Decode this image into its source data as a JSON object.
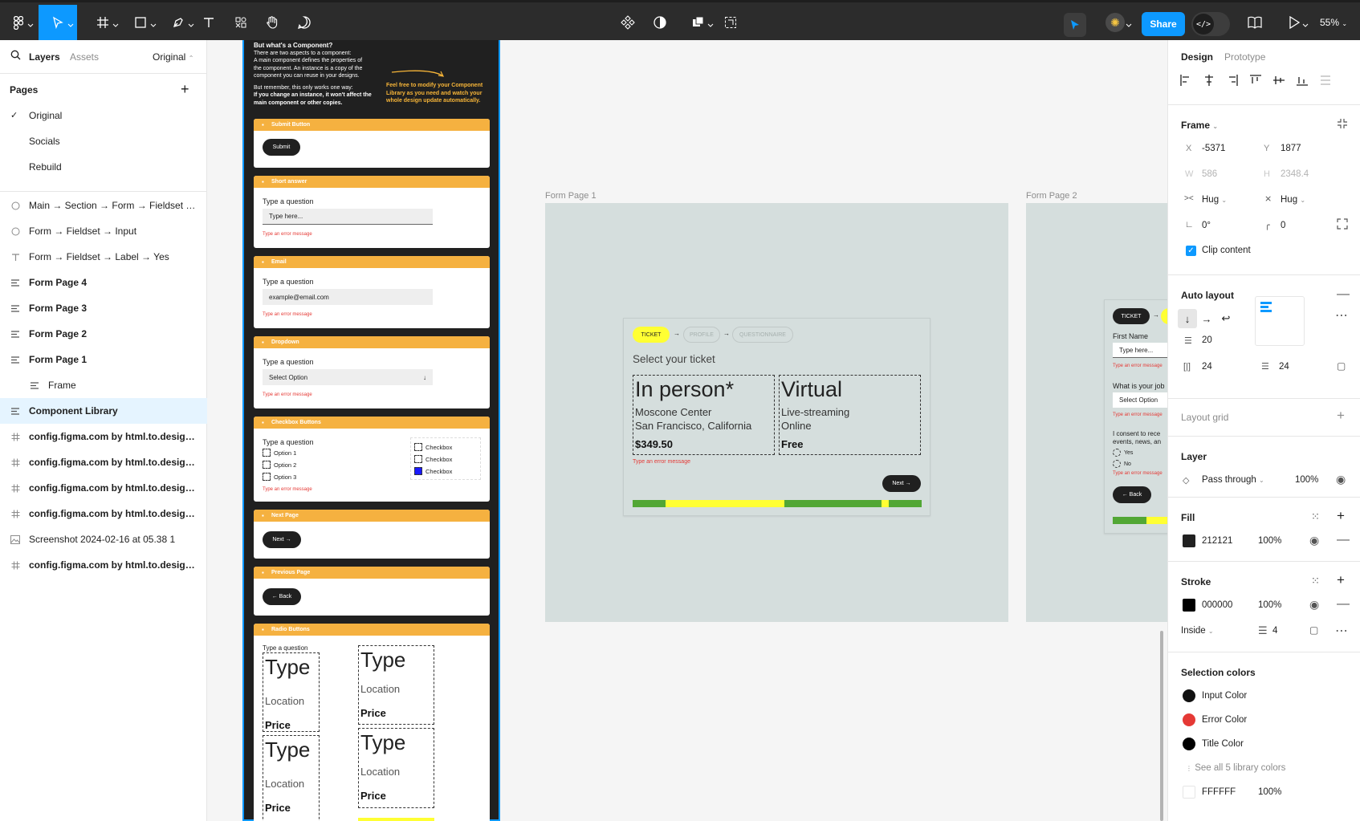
{
  "toolbar": {
    "share": "Share",
    "zoom": "55%",
    "dev_mode": "</>"
  },
  "left_panel": {
    "tabs": {
      "layers": "Layers",
      "assets": "Assets",
      "page_selector": "Original"
    },
    "pages_heading": "Pages",
    "pages": [
      {
        "name": "Original",
        "current": true
      },
      {
        "name": "Socials",
        "current": false
      },
      {
        "name": "Rebuild",
        "current": false
      }
    ],
    "layers": [
      {
        "name": "Main → Section → Form → Fieldset → ...",
        "icon": "ellipse-icon",
        "bold": false
      },
      {
        "name": "Form → Fieldset → Input",
        "icon": "ellipse-icon",
        "bold": false
      },
      {
        "name": "Form → Fieldset → Label → Yes",
        "icon": "text-icon",
        "bold": false
      },
      {
        "name": "Form Page 4",
        "icon": "autolayout-icon",
        "bold": true
      },
      {
        "name": "Form Page 3",
        "icon": "autolayout-icon",
        "bold": true
      },
      {
        "name": "Form Page 2",
        "icon": "autolayout-icon",
        "bold": true
      },
      {
        "name": "Form Page 1",
        "icon": "autolayout-icon",
        "bold": true
      },
      {
        "name": "Frame",
        "icon": "autolayout-icon",
        "bold": false,
        "indent": true
      },
      {
        "name": "Component Library",
        "icon": "autolayout-icon",
        "bold": true,
        "selected": true
      },
      {
        "name": "config.figma.com by html.to.design ❤...",
        "icon": "frame-icon",
        "bold": true
      },
      {
        "name": "config.figma.com by html.to.design ❤...",
        "icon": "frame-icon",
        "bold": true
      },
      {
        "name": "config.figma.com by html.to.design ❤...",
        "icon": "frame-icon",
        "bold": true
      },
      {
        "name": "config.figma.com by html.to.design ❤...",
        "icon": "frame-icon",
        "bold": true
      },
      {
        "name": "Screenshot 2024-02-16 at 05.38 1",
        "icon": "image-icon",
        "bold": false
      },
      {
        "name": "config.figma.com by html.to.design ❤...",
        "icon": "frame-icon",
        "bold": true
      }
    ]
  },
  "library": {
    "intro_heading": "But what's a Component?",
    "intro_text_1": "There are two aspects to a component:",
    "intro_text_2": "A main component defines the properties of",
    "intro_text_3": "the component. An instance is a copy of the",
    "intro_text_4": "component you can reuse in your designs.",
    "intro_text_5": "But remember, this only works one way:",
    "intro_text_6": "If you change an instance, it won't affect the",
    "intro_text_7": "main component or other copies.",
    "highlight_1": "Feel free to modify your Component",
    "highlight_2": "Library as you need and watch your",
    "highlight_3": "whole design update automatically.",
    "submit": {
      "header": "Submit Button",
      "label": "Submit"
    },
    "short_answer": {
      "header": "Short answer",
      "question": "Type a question",
      "placeholder": "Type here...",
      "error": "Type an error message"
    },
    "email": {
      "header": "Email",
      "question": "Type a question",
      "placeholder": "example@email.com",
      "error": "Type an error message"
    },
    "dropdown": {
      "header": "Dropdown",
      "question": "Type a question",
      "value": "Select Option",
      "error": "Type an error message"
    },
    "checkbox": {
      "header": "Checkbox Buttons",
      "question": "Type a question",
      "options": [
        "Option 1",
        "Option 2",
        "Option 3"
      ],
      "variants": [
        "Checkbox",
        "Checkbox",
        "Checkbox"
      ],
      "error": "Type an error message"
    },
    "next_page": {
      "header": "Next Page",
      "label": "Next →"
    },
    "previous_page": {
      "header": "Previous Page",
      "label": "← Back"
    },
    "radio": {
      "header": "Radio Buttons",
      "question": "Type a question",
      "cards": [
        {
          "type": "Type",
          "location": "Location",
          "price": "Price"
        },
        {
          "type": "Type",
          "location": "Location",
          "price": "Price"
        },
        {
          "type": "Type",
          "location": "Location",
          "price": "Price"
        },
        {
          "type": "Type",
          "location": "Location",
          "price": "Price"
        }
      ]
    }
  },
  "frame1": {
    "label": "Form Page 1",
    "steps": [
      "TICKET",
      "PROFILE",
      "QUESTIONNAIRE"
    ],
    "title": "Select your ticket",
    "tickets": [
      {
        "type": "In person*",
        "loc1": "Moscone Center",
        "loc2": "San Francisco, California",
        "price": "$349.50"
      },
      {
        "type": "Virtual",
        "loc1": "Live-streaming",
        "loc2": "Online",
        "price": "Free"
      }
    ],
    "error": "Type an error message",
    "next": "Next →"
  },
  "frame2": {
    "label": "Form Page 2",
    "step": "TICKET",
    "first_name": "First Name",
    "placeholder": "Type here...",
    "error": "Type an error message",
    "job": "What is your job",
    "select": "Select Option",
    "consent_1": "I consent to rece",
    "consent_2": "events, news, an",
    "yes": "Yes",
    "no": "No",
    "back": "← Back"
  },
  "right_panel": {
    "tabs": {
      "design": "Design",
      "prototype": "Prototype"
    },
    "frame": {
      "heading": "Frame",
      "x_label": "X",
      "x": "-5371",
      "y_label": "Y",
      "y": "1877",
      "w_label": "W",
      "w": "586",
      "h_label": "H",
      "h": "2348.4",
      "hug_w": "Hug",
      "hug_h": "Hug",
      "rotation": "0°",
      "radius": "0",
      "clip": "Clip content"
    },
    "auto_layout": {
      "heading": "Auto layout",
      "gap": "20",
      "padding_h": "24",
      "padding_v": "24"
    },
    "layout_grid": {
      "heading": "Layout grid"
    },
    "layer": {
      "heading": "Layer",
      "blend": "Pass through",
      "opacity": "100%"
    },
    "fill": {
      "heading": "Fill",
      "hex": "212121",
      "opacity": "100%",
      "color": "#212121"
    },
    "stroke": {
      "heading": "Stroke",
      "hex": "000000",
      "opacity": "100%",
      "position": "Inside",
      "weight": "4",
      "color": "#000000"
    },
    "selection_colors": {
      "heading": "Selection colors",
      "items": [
        {
          "name": "Input Color",
          "color": "#111111"
        },
        {
          "name": "Error Color",
          "color": "#e53935"
        },
        {
          "name": "Title Color",
          "color": "#000000"
        }
      ],
      "see_all": "See all 5 library colors",
      "last_hex": "FFFFFF",
      "last_opacity": "100%"
    }
  },
  "colors": {
    "accent": "#0d99ff",
    "toolbar": "#2c2c2c",
    "component_header": "#f5b140",
    "step_active": "#ffff33",
    "progress_green": "#52a735",
    "progress_yellow": "#ffff33"
  }
}
